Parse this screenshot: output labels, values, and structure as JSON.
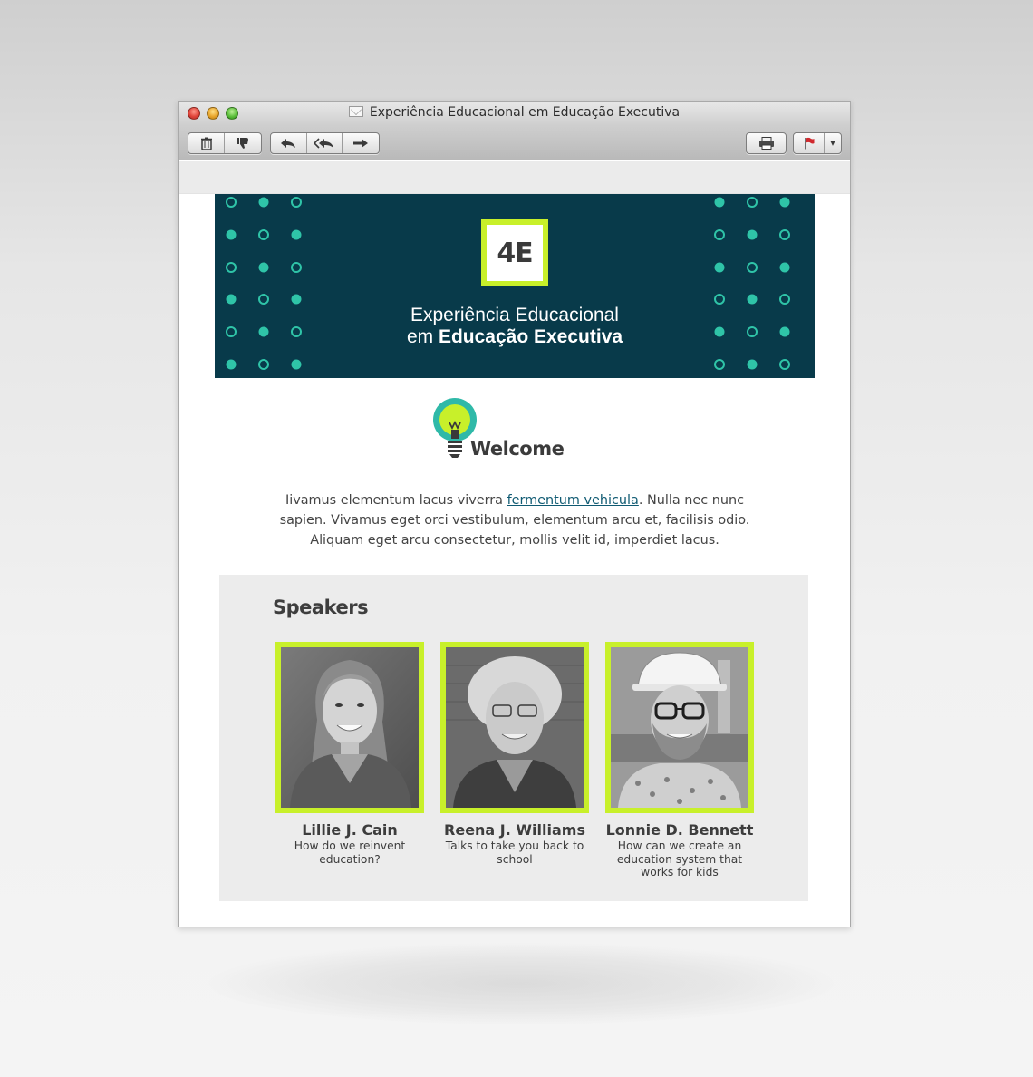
{
  "window": {
    "title": "Experiência Educacional em Educação Executiva"
  },
  "toolbar": {
    "left_group_1": [
      {
        "icon": "trash-icon",
        "glyph": "🗑"
      },
      {
        "icon": "junk-thumbs-down-icon",
        "glyph": "👎"
      }
    ],
    "left_group_2": [
      {
        "icon": "reply-icon",
        "glyph": "↩"
      },
      {
        "icon": "reply-all-icon",
        "glyph": "⟪"
      },
      {
        "icon": "forward-icon",
        "glyph": "➜"
      }
    ],
    "right_print": {
      "icon": "print-icon",
      "glyph": "🖶"
    },
    "right_flag": {
      "icon": "flag-icon",
      "glyph": "⚑",
      "dropdown_glyph": "▾"
    }
  },
  "banner": {
    "logo": "4E",
    "line1": "Experiência Educacional",
    "line2_prefix": "em ",
    "line2_bold": "Educação Executiva",
    "background": "#083a4a",
    "accent": "#c8f02a",
    "dot_color": "#2fc4a8"
  },
  "welcome": {
    "heading": "Welcome",
    "icon": "lightbulb-icon"
  },
  "intro": {
    "before_link": "Iivamus elementum lacus viverra ",
    "link": "fermentum vehicula",
    "after_link": ". Nulla nec nunc sapien. Vivamus eget orci vestibulum, elementum arcu et, facilisis odio. Aliquam eget arcu consectetur, mollis velit id, imperdiet lacus."
  },
  "speakers": {
    "title": "Speakers",
    "items": [
      {
        "name": "Lillie J. Cain",
        "talk": "How do we reinvent education?"
      },
      {
        "name": "Reena J. Williams",
        "talk": "Talks to take you back to school"
      },
      {
        "name": "Lonnie D. Bennett",
        "talk": "How can we create an education system that works for kids"
      }
    ]
  }
}
